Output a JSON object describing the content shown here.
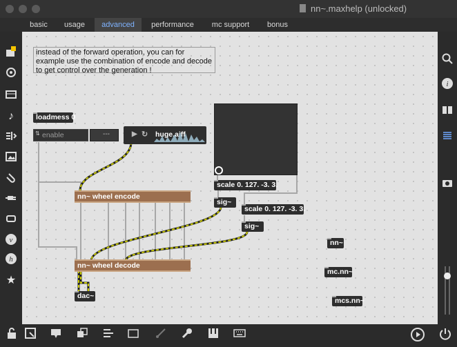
{
  "window": {
    "title": "nn~.maxhelp (unlocked)"
  },
  "tabs": [
    {
      "label": "basic",
      "active": false
    },
    {
      "label": "usage",
      "active": false
    },
    {
      "label": "advanced",
      "active": true
    },
    {
      "label": "performance",
      "active": false
    },
    {
      "label": "mc support",
      "active": false
    },
    {
      "label": "bonus",
      "active": false
    }
  ],
  "canvas": {
    "comment": "instead of the forward operation, you can for example use the combination of encode and decode to get control over the generation !",
    "objects": {
      "loadmess": "loadmess 0",
      "toggle_label": "enable",
      "number_value": "---",
      "playlist_file": "huge.aiff",
      "wheel_encode": "nn~ wheel encode",
      "wheel_decode": "nn~ wheel decode",
      "scale1": "scale 0. 127. -3. 3.",
      "scale2": "scale 0. 127. -3. 3.",
      "sig1": "sig~",
      "sig2": "sig~",
      "dac": "dac~",
      "nn": "nn~",
      "mcnn": "mc.nn~",
      "mcsnn": "mcs.nn~"
    }
  },
  "sidebar_left": [
    "package-icon",
    "search-icon",
    "browser-icon",
    "music-note-icon",
    "audio-routing-icon",
    "image-icon",
    "paperclip-icon",
    "plug-icon",
    "cord-icon",
    "vimeo-icon",
    "help-icon",
    "star-icon"
  ],
  "sidebar_right": [
    "search-icon",
    "info-icon",
    "book-icon",
    "list-icon",
    "camera-icon",
    "volume-icon",
    "power-icon"
  ],
  "bottom_bar": [
    "lock-icon",
    "open-object-icon",
    "comment-icon",
    "presentation-icon",
    "mixer-icon",
    "patch-cord-icon",
    "wrench-icon",
    "piano-icon",
    "keyboard-icon",
    "play-icon"
  ],
  "colors": {
    "canvas_bg": "#e2e2e2",
    "object_bg": "#2e2e2e",
    "wheel_bg": "#9c6f4f",
    "accent": "#7fb3ff"
  }
}
